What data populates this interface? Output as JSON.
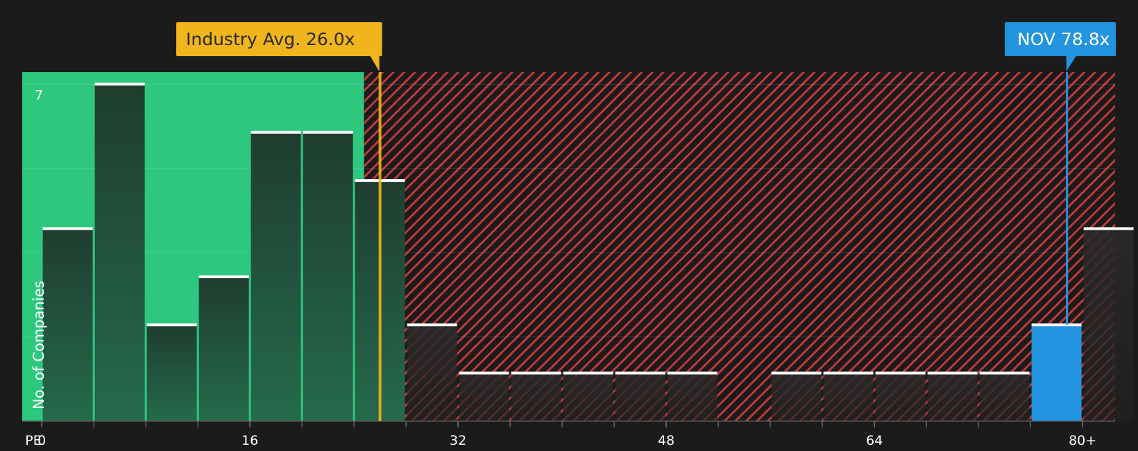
{
  "chart_data": {
    "type": "bar",
    "x_axis_label": "PE",
    "ylabel": "No. of Companies",
    "x_range": [
      -1.5,
      82.5
    ],
    "ylim": [
      0,
      7.25
    ],
    "x_ticks": [
      {
        "value": 0,
        "label": "0"
      },
      {
        "value": 16,
        "label": "16"
      },
      {
        "value": 32,
        "label": "32"
      },
      {
        "value": 48,
        "label": "48"
      },
      {
        "value": 64,
        "label": "64"
      },
      {
        "value": 80,
        "label": "80+"
      }
    ],
    "minor_ticks": [
      4,
      8,
      12,
      20,
      24,
      28,
      36,
      40,
      44,
      52,
      56,
      60,
      68,
      72,
      76
    ],
    "y_gridlines": [
      1.75,
      3.5,
      5.25,
      7
    ],
    "y_tick_labels": [
      {
        "value": 7,
        "label": "7"
      }
    ],
    "bins": [
      {
        "x0": 0,
        "x1": 4,
        "count": 4
      },
      {
        "x0": 4,
        "x1": 8,
        "count": 7
      },
      {
        "x0": 8,
        "x1": 12,
        "count": 2
      },
      {
        "x0": 12,
        "x1": 16,
        "count": 3
      },
      {
        "x0": 16,
        "x1": 20,
        "count": 6
      },
      {
        "x0": 20,
        "x1": 24,
        "count": 6
      },
      {
        "x0": 24,
        "x1": 28,
        "count": 5
      },
      {
        "x0": 28,
        "x1": 32,
        "count": 2
      },
      {
        "x0": 32,
        "x1": 36,
        "count": 1
      },
      {
        "x0": 36,
        "x1": 40,
        "count": 1
      },
      {
        "x0": 40,
        "x1": 44,
        "count": 1
      },
      {
        "x0": 44,
        "x1": 48,
        "count": 1
      },
      {
        "x0": 48,
        "x1": 52,
        "count": 1
      },
      {
        "x0": 52,
        "x1": 56,
        "count": 0
      },
      {
        "x0": 56,
        "x1": 60,
        "count": 1
      },
      {
        "x0": 60,
        "x1": 64,
        "count": 1
      },
      {
        "x0": 64,
        "x1": 68,
        "count": 1
      },
      {
        "x0": 68,
        "x1": 72,
        "count": 1
      },
      {
        "x0": 72,
        "x1": 76,
        "count": 1
      },
      {
        "x0": 76,
        "x1": 80,
        "count": 2,
        "highlight": true
      },
      {
        "x0": 80,
        "x1": 84,
        "count": 4
      }
    ],
    "industry_avg": {
      "value": 26.0,
      "label": "Industry Avg. 26.0x"
    },
    "company": {
      "value": 78.8,
      "label": "NOV 78.8x"
    },
    "colors": {
      "background": "#1b1b1b",
      "green_zone": "#2ec77e",
      "red_zone_stripe": "#c0393b",
      "bar_dark": "#1e3b2f",
      "bar_cap": "#ffffff",
      "industry": "#f0b41c",
      "company": "#2394e0"
    }
  }
}
